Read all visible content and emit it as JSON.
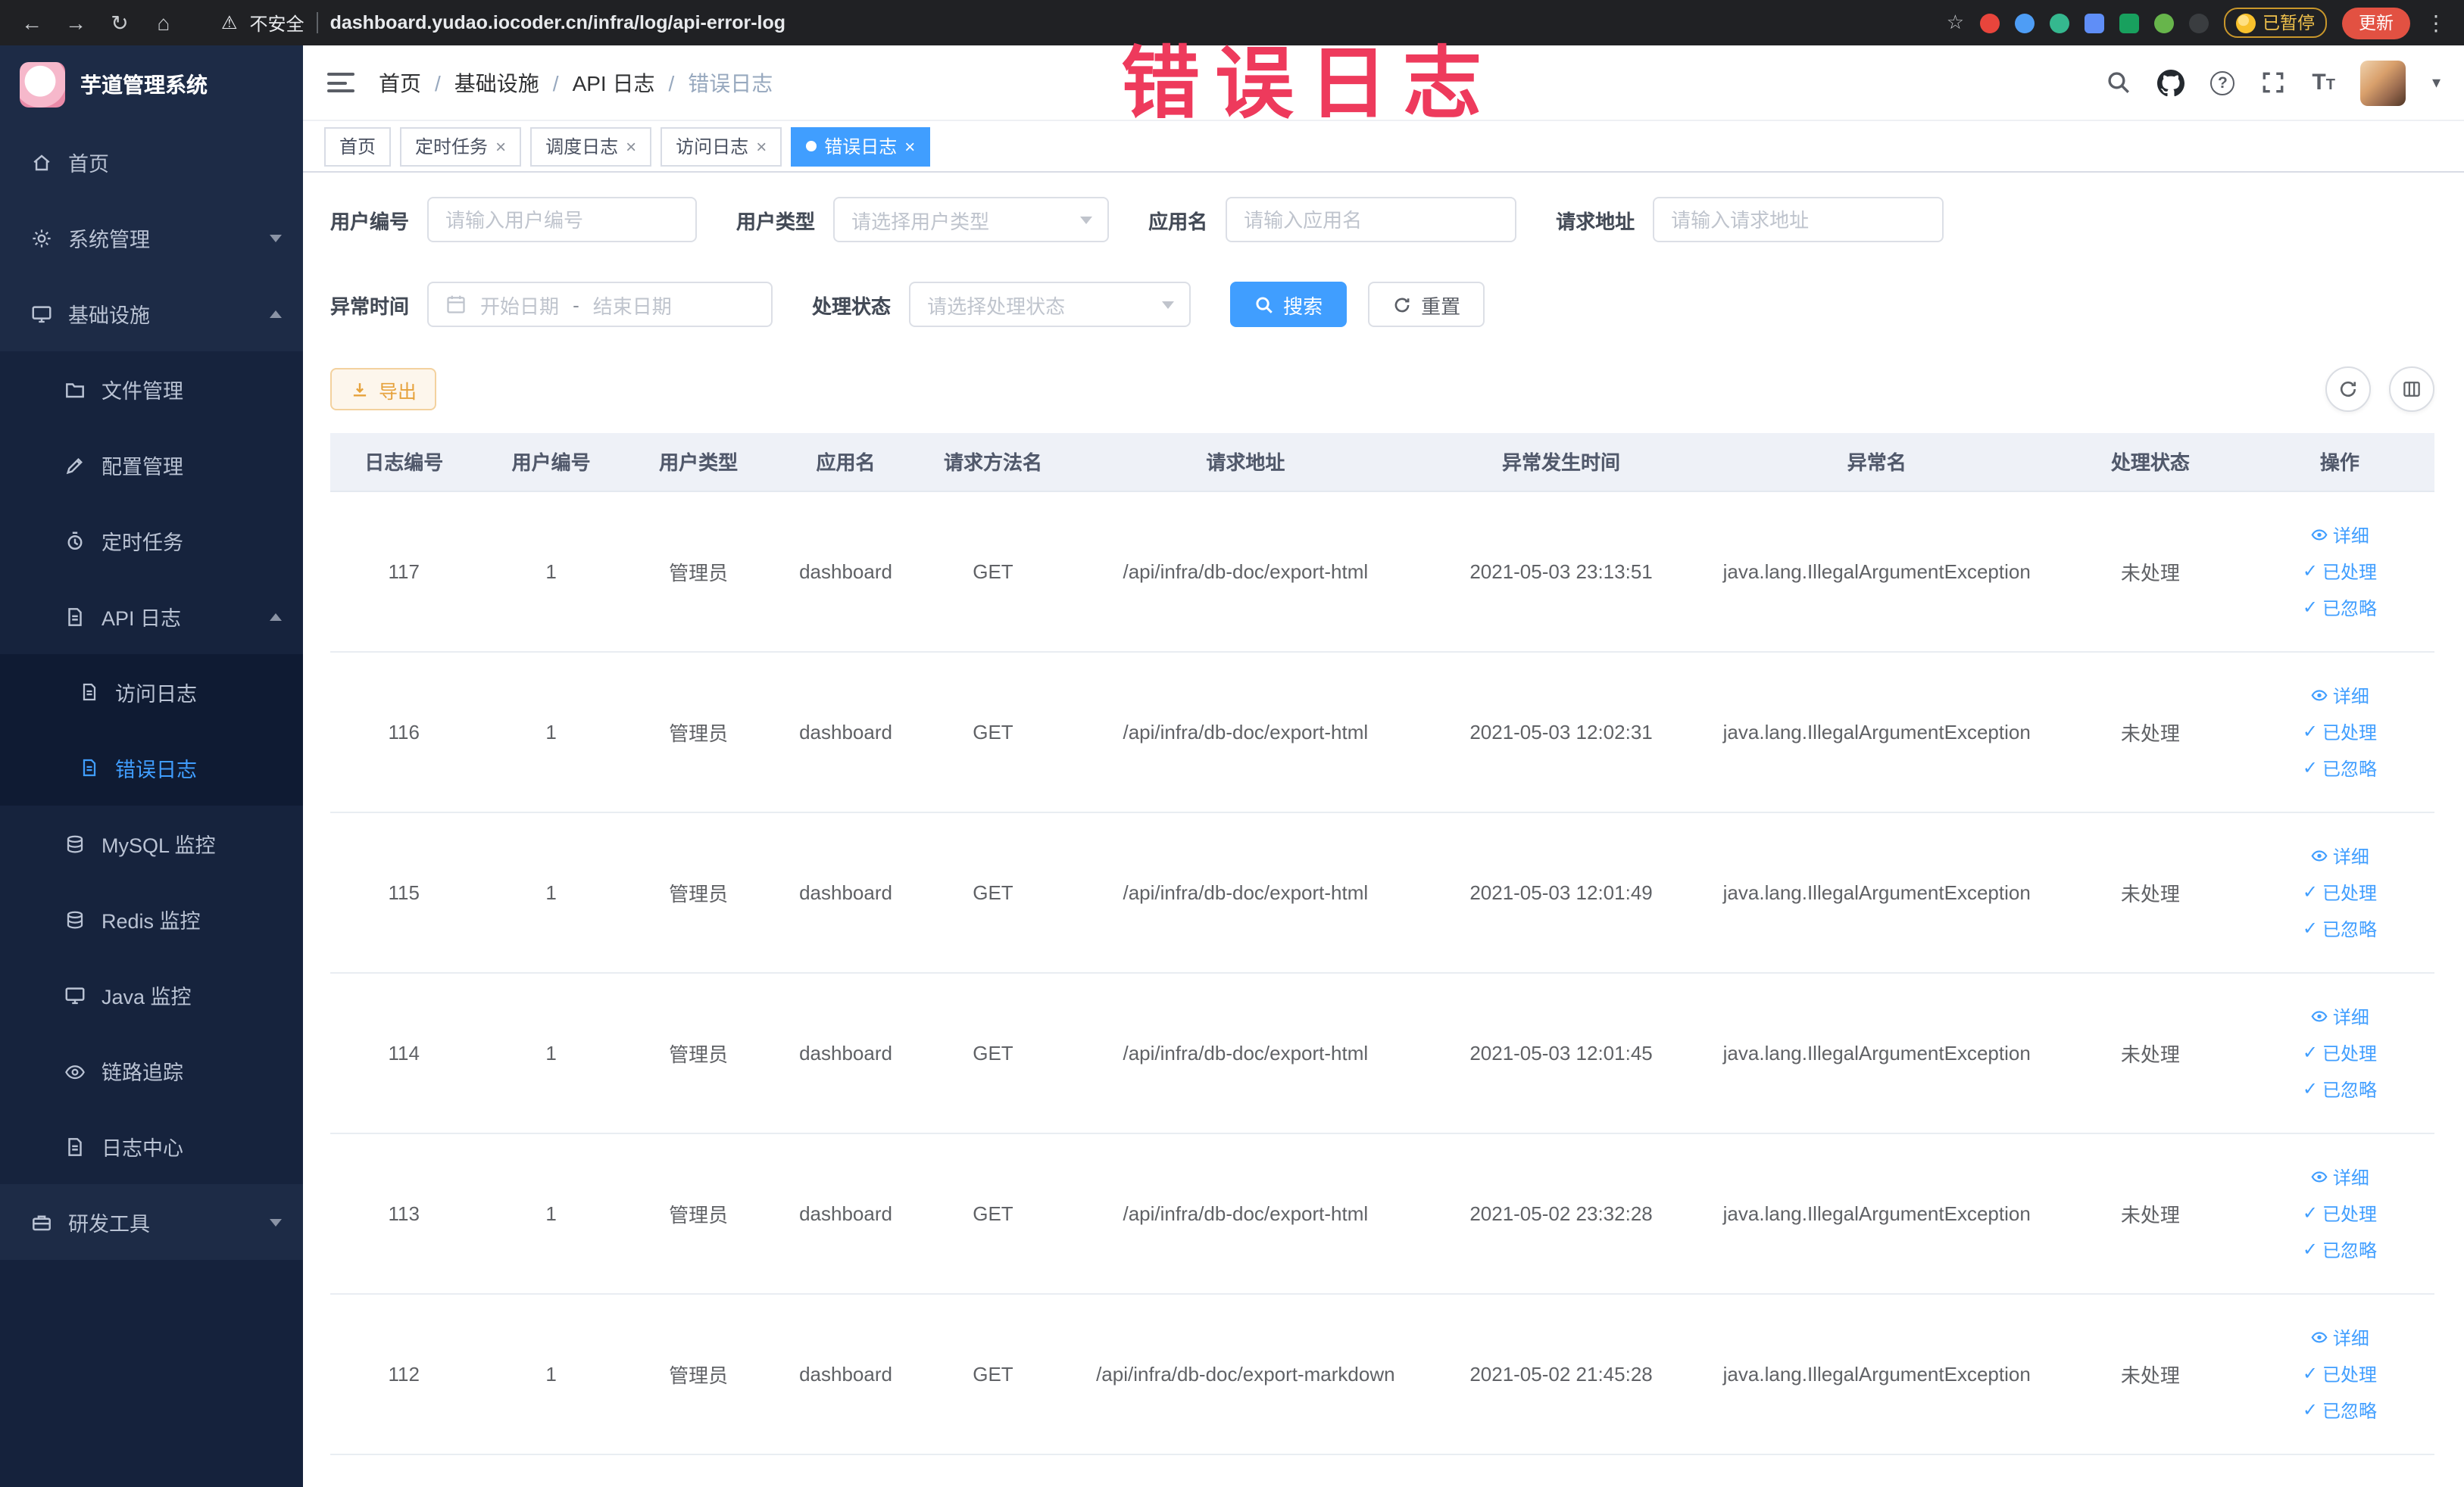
{
  "browser": {
    "security_label": "不安全",
    "url": "dashboard.yudao.iocoder.cn/infra/log/api-error-log",
    "paused_badge": "已暂停",
    "update_button": "更新"
  },
  "annotation": {
    "text": "错误日志",
    "color": "#ee3a5c"
  },
  "colors": {
    "accent": "#409eff",
    "warning": "#e6a23c",
    "sidebar_bg": "#1d2b46"
  },
  "icons": {
    "close": "×",
    "back": "←",
    "forward": "→",
    "reload": "↻",
    "home": "⌂",
    "warning": "⚠",
    "star": "☆",
    "kebab": "⋮",
    "caret_down": "▾",
    "question": "?",
    "check": "✓",
    "breadcrumb_separator": "/",
    "range_separator": "-",
    "font": "T"
  },
  "sidebar": {
    "title": "芋道管理系统",
    "items": [
      {
        "label": "首页"
      },
      {
        "label": "系统管理"
      },
      {
        "label": "基础设施"
      },
      {
        "label": "文件管理"
      },
      {
        "label": "配置管理"
      },
      {
        "label": "定时任务"
      },
      {
        "label": "API 日志"
      },
      {
        "label": "访问日志"
      },
      {
        "label": "错误日志"
      },
      {
        "label": "MySQL 监控"
      },
      {
        "label": "Redis 监控"
      },
      {
        "label": "Java 监控"
      },
      {
        "label": "链路追踪"
      },
      {
        "label": "日志中心"
      },
      {
        "label": "研发工具"
      }
    ]
  },
  "breadcrumb": {
    "items": [
      "首页",
      "基础设施",
      "API 日志",
      "错误日志"
    ]
  },
  "tabs": [
    {
      "label": "首页",
      "closable": false,
      "active": false
    },
    {
      "label": "定时任务",
      "closable": true,
      "active": false
    },
    {
      "label": "调度日志",
      "closable": true,
      "active": false
    },
    {
      "label": "访问日志",
      "closable": true,
      "active": false
    },
    {
      "label": "错误日志",
      "closable": true,
      "active": true
    }
  ],
  "filters": {
    "user_id": {
      "label": "用户编号",
      "placeholder": "请输入用户编号"
    },
    "user_type": {
      "label": "用户类型",
      "placeholder": "请选择用户类型"
    },
    "app_name": {
      "label": "应用名",
      "placeholder": "请输入应用名"
    },
    "request_url": {
      "label": "请求地址",
      "placeholder": "请输入请求地址"
    },
    "exception_time": {
      "label": "异常时间",
      "start_placeholder": "开始日期",
      "end_placeholder": "结束日期"
    },
    "process_status": {
      "label": "处理状态",
      "placeholder": "请选择处理状态"
    },
    "search_button": "搜索",
    "reset_button": "重置"
  },
  "toolbar": {
    "export_button": "导出"
  },
  "table": {
    "headers": [
      "日志编号",
      "用户编号",
      "用户类型",
      "应用名",
      "请求方法名",
      "请求地址",
      "异常发生时间",
      "异常名",
      "处理状态",
      "操作"
    ],
    "actions": [
      "详细",
      "已处理",
      "已忽略"
    ],
    "rows": [
      {
        "id": "117",
        "user_id": "1",
        "user_type": "管理员",
        "app": "dashboard",
        "method": "GET",
        "url": "/api/infra/db-doc/export-html",
        "time": "2021-05-03 23:13:51",
        "exception": "java.lang.IllegalArgumentException",
        "status": "未处理"
      },
      {
        "id": "116",
        "user_id": "1",
        "user_type": "管理员",
        "app": "dashboard",
        "method": "GET",
        "url": "/api/infra/db-doc/export-html",
        "time": "2021-05-03 12:02:31",
        "exception": "java.lang.IllegalArgumentException",
        "status": "未处理"
      },
      {
        "id": "115",
        "user_id": "1",
        "user_type": "管理员",
        "app": "dashboard",
        "method": "GET",
        "url": "/api/infra/db-doc/export-html",
        "time": "2021-05-03 12:01:49",
        "exception": "java.lang.IllegalArgumentException",
        "status": "未处理"
      },
      {
        "id": "114",
        "user_id": "1",
        "user_type": "管理员",
        "app": "dashboard",
        "method": "GET",
        "url": "/api/infra/db-doc/export-html",
        "time": "2021-05-03 12:01:45",
        "exception": "java.lang.IllegalArgumentException",
        "status": "未处理"
      },
      {
        "id": "113",
        "user_id": "1",
        "user_type": "管理员",
        "app": "dashboard",
        "method": "GET",
        "url": "/api/infra/db-doc/export-html",
        "time": "2021-05-02 23:32:28",
        "exception": "java.lang.IllegalArgumentException",
        "status": "未处理"
      },
      {
        "id": "112",
        "user_id": "1",
        "user_type": "管理员",
        "app": "dashboard",
        "method": "GET",
        "url": "/api/infra/db-doc/export-markdown",
        "time": "2021-05-02 21:45:28",
        "exception": "java.lang.IllegalArgumentException",
        "status": "未处理"
      }
    ]
  }
}
